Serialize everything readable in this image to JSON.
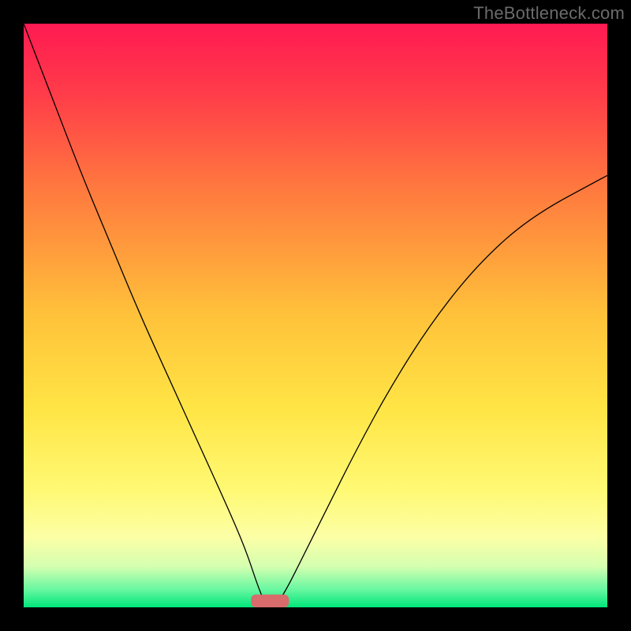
{
  "watermark": "TheBottleneck.com",
  "chart_data": {
    "type": "line",
    "title": "",
    "xlabel": "",
    "ylabel": "",
    "xlim": [
      0,
      1
    ],
    "ylim": [
      0,
      1
    ],
    "axes_visible": false,
    "background_gradient": {
      "stops": [
        {
          "offset": 0.0,
          "color": "#ff1a52"
        },
        {
          "offset": 0.12,
          "color": "#ff3c49"
        },
        {
          "offset": 0.28,
          "color": "#ff783f"
        },
        {
          "offset": 0.5,
          "color": "#ffc23a"
        },
        {
          "offset": 0.66,
          "color": "#ffe545"
        },
        {
          "offset": 0.8,
          "color": "#fff974"
        },
        {
          "offset": 0.88,
          "color": "#fcffa6"
        },
        {
          "offset": 0.93,
          "color": "#d4ffb0"
        },
        {
          "offset": 0.97,
          "color": "#66f7a0"
        },
        {
          "offset": 1.0,
          "color": "#00e57a"
        }
      ]
    },
    "series": [
      {
        "name": "left-curve",
        "x": [
          0.0,
          0.05,
          0.1,
          0.15,
          0.2,
          0.25,
          0.3,
          0.35,
          0.38,
          0.4,
          0.41,
          0.415
        ],
        "y": [
          1.0,
          0.87,
          0.74,
          0.62,
          0.5,
          0.39,
          0.28,
          0.17,
          0.1,
          0.04,
          0.015,
          0.0
        ]
      },
      {
        "name": "right-curve",
        "x": [
          0.43,
          0.45,
          0.48,
          0.52,
          0.57,
          0.63,
          0.7,
          0.78,
          0.87,
          1.0
        ],
        "y": [
          0.0,
          0.03,
          0.09,
          0.17,
          0.27,
          0.38,
          0.49,
          0.59,
          0.67,
          0.74
        ]
      }
    ],
    "marker": {
      "name": "bottleneck-pill",
      "x_center": 0.422,
      "y": 0.0,
      "width": 0.065,
      "height": 0.022,
      "color": "#d86b6b"
    }
  }
}
